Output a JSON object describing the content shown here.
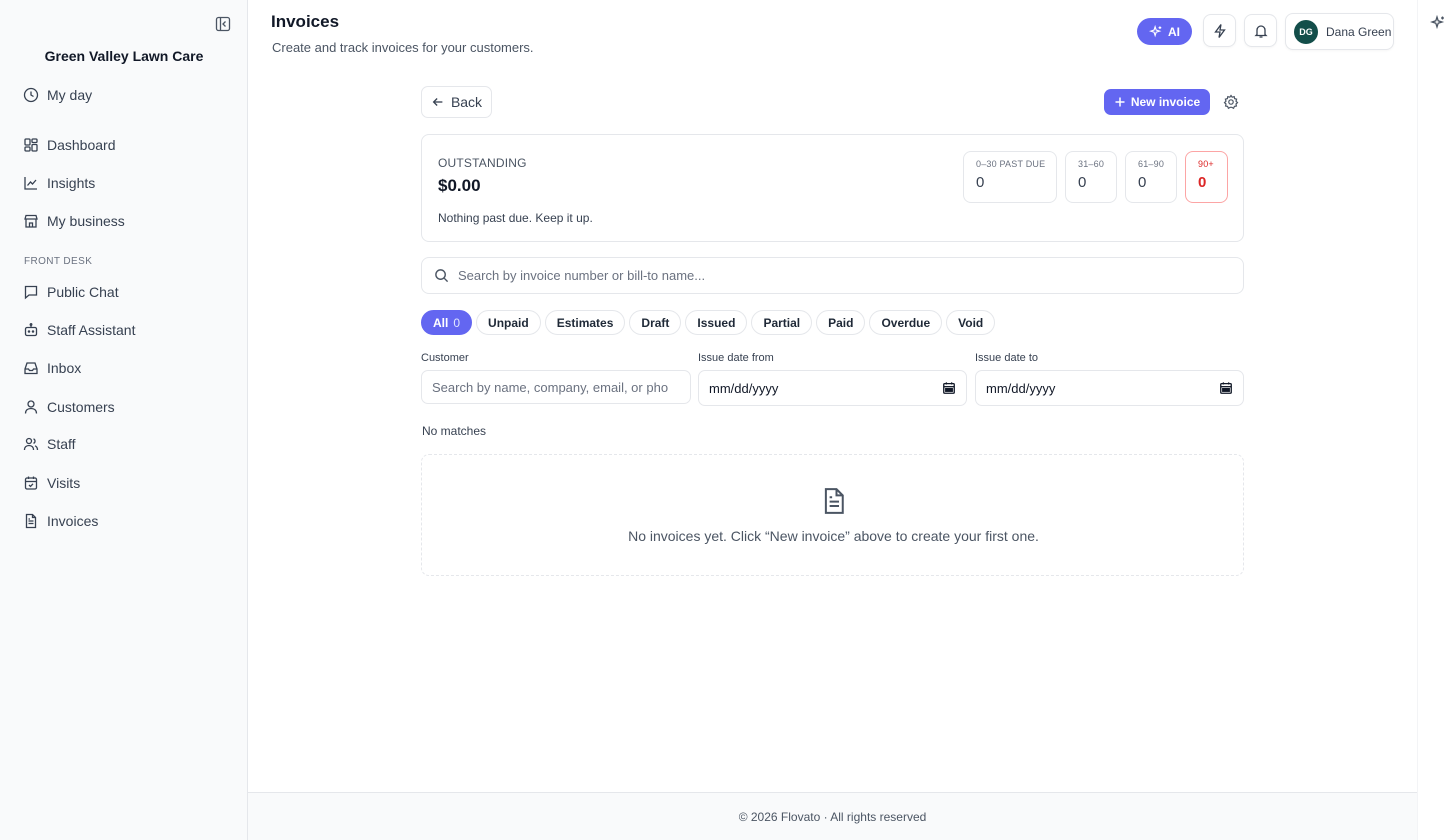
{
  "sidebar": {
    "brand": "Green Valley Lawn Care",
    "collapse_icon": "sidebar-collapse-icon",
    "items": [
      {
        "label": "My day",
        "icon": "clock-icon"
      },
      {
        "label": "Dashboard",
        "icon": "dashboard-grid-icon"
      },
      {
        "label": "Insights",
        "icon": "line-chart-icon"
      },
      {
        "label": "My business",
        "icon": "store-icon"
      },
      {
        "label": "Public Chat",
        "icon": "chat-bubble-icon"
      },
      {
        "label": "Staff Assistant",
        "icon": "bot-icon"
      },
      {
        "label": "Inbox",
        "icon": "inbox-icon"
      },
      {
        "label": "Customers",
        "icon": "user-icon"
      },
      {
        "label": "Staff",
        "icon": "users-icon"
      },
      {
        "label": "Visits",
        "icon": "calendar-check-icon"
      },
      {
        "label": "Invoices",
        "icon": "file-text-icon"
      }
    ],
    "section_label": "FRONT DESK"
  },
  "header": {
    "title": "Invoices",
    "subtitle": "Create and track invoices for your customers.",
    "ai_label": "AI",
    "user": {
      "initials": "DG",
      "name": "Dana Green"
    }
  },
  "toolbar": {
    "back_label": "Back",
    "new_invoice_label": "New invoice"
  },
  "summary": {
    "outstanding_label": "OUTSTANDING",
    "outstanding_amount": "$0.00",
    "note": "Nothing past due. Keep it up.",
    "buckets": [
      {
        "label": "0–30 PAST DUE",
        "value": "0"
      },
      {
        "label": "31–60",
        "value": "0"
      },
      {
        "label": "61–90",
        "value": "0"
      },
      {
        "label": "90+",
        "value": "0"
      }
    ]
  },
  "search": {
    "placeholder": "Search by invoice number or bill-to name..."
  },
  "filters": {
    "chips": [
      {
        "label": "All",
        "count": "0"
      },
      {
        "label": "Unpaid"
      },
      {
        "label": "Estimates"
      },
      {
        "label": "Draft"
      },
      {
        "label": "Issued"
      },
      {
        "label": "Partial"
      },
      {
        "label": "Paid"
      },
      {
        "label": "Overdue"
      },
      {
        "label": "Void"
      }
    ],
    "customer_label": "Customer",
    "customer_placeholder": "Search by name, company, email, or pho",
    "date_from_label": "Issue date from",
    "date_from_value": "mm/dd/yyyy",
    "date_to_label": "Issue date to",
    "date_to_value": "mm/dd/yyyy"
  },
  "results": {
    "status": "No matches",
    "empty_text": "No invoices yet. Click “New invoice” above to create your first one."
  },
  "footer": {
    "text": "© 2026 Flovato · All rights reserved"
  },
  "colors": {
    "accent": "#6366f1",
    "danger": "#dc2626",
    "avatar": "#134e4a"
  }
}
